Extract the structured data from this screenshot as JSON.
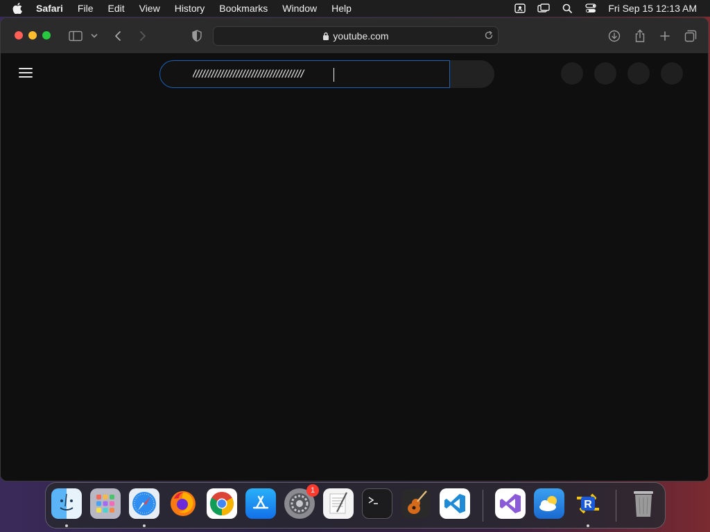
{
  "menubar": {
    "app_name": "Safari",
    "items": [
      "File",
      "Edit",
      "View",
      "History",
      "Bookmarks",
      "Window",
      "Help"
    ],
    "clock": "Fri Sep 15  12:13 AM"
  },
  "browser": {
    "address": "youtube.com"
  },
  "page": {
    "search_value": "////////////////////////////////////"
  },
  "dock": {
    "system_settings_badge": "1"
  },
  "colors": {
    "search_focus_border": "#1c62b9",
    "page_background": "#0f0f0f",
    "toolbar_background": "#2b2b2b"
  }
}
